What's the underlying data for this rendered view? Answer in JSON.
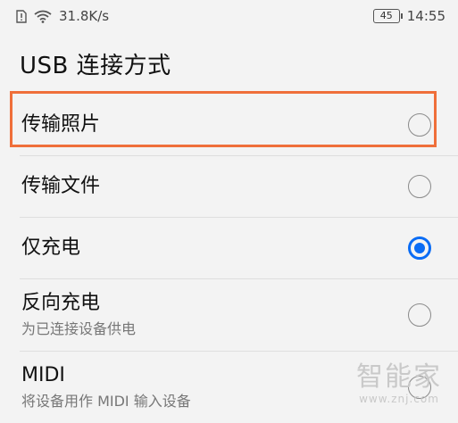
{
  "status_bar": {
    "speed": "31.8K/s",
    "battery": "45",
    "time": "14:55"
  },
  "page": {
    "title": "USB 连接方式"
  },
  "options": [
    {
      "label": "传输照片",
      "subtitle": "",
      "selected": false
    },
    {
      "label": "传输文件",
      "subtitle": "",
      "selected": false
    },
    {
      "label": "仅充电",
      "subtitle": "",
      "selected": true
    },
    {
      "label": "反向充电",
      "subtitle": "为已连接设备供电",
      "selected": false
    },
    {
      "label": "MIDI",
      "subtitle": "将设备用作 MIDI 输入设备",
      "selected": false
    }
  ],
  "watermark": {
    "main": "智能家",
    "url": "www.znj.com"
  },
  "colors": {
    "accent": "#0a6cf5",
    "highlight": "#ef6f3a",
    "background": "#f3f3f3"
  },
  "icons": [
    "sim-alert-icon",
    "wifi-icon",
    "battery-icon"
  ]
}
